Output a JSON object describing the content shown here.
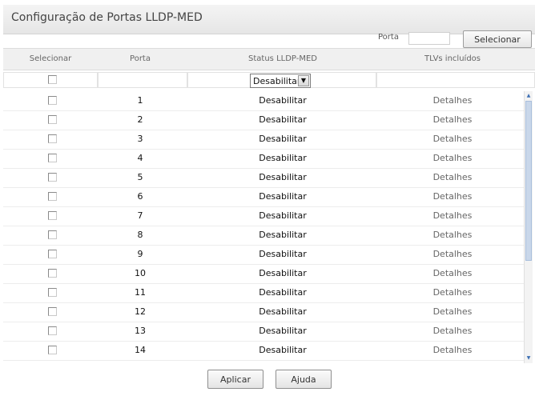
{
  "panel": {
    "title": "Configuração de Portas LLDP-MED"
  },
  "port_search": {
    "label": "Porta",
    "value": "",
    "button_label": "Selecionar"
  },
  "table": {
    "headers": [
      "Selecionar",
      "Porta",
      "Status LLDP-MED",
      "TLVs incluídos"
    ],
    "filter": {
      "status_value": "Desabilitar"
    },
    "rows": [
      {
        "port": "1",
        "status": "Desabilitar",
        "details": "Detalhes"
      },
      {
        "port": "2",
        "status": "Desabilitar",
        "details": "Detalhes"
      },
      {
        "port": "3",
        "status": "Desabilitar",
        "details": "Detalhes"
      },
      {
        "port": "4",
        "status": "Desabilitar",
        "details": "Detalhes"
      },
      {
        "port": "5",
        "status": "Desabilitar",
        "details": "Detalhes"
      },
      {
        "port": "6",
        "status": "Desabilitar",
        "details": "Detalhes"
      },
      {
        "port": "7",
        "status": "Desabilitar",
        "details": "Detalhes"
      },
      {
        "port": "8",
        "status": "Desabilitar",
        "details": "Detalhes"
      },
      {
        "port": "9",
        "status": "Desabilitar",
        "details": "Detalhes"
      },
      {
        "port": "10",
        "status": "Desabilitar",
        "details": "Detalhes"
      },
      {
        "port": "11",
        "status": "Desabilitar",
        "details": "Detalhes"
      },
      {
        "port": "12",
        "status": "Desabilitar",
        "details": "Detalhes"
      },
      {
        "port": "13",
        "status": "Desabilitar",
        "details": "Detalhes"
      },
      {
        "port": "14",
        "status": "Desabilitar",
        "details": "Detalhes"
      }
    ]
  },
  "actions": {
    "apply_label": "Aplicar",
    "help_label": "Ajuda"
  },
  "icons": {
    "dropdown": "chevron-down-icon",
    "scroll_up": "arrow-up-icon",
    "scroll_down": "arrow-down-icon"
  },
  "colors": {
    "title_bar": "#e9e9e9",
    "header_row": "#f0f0f0",
    "scroll_thumb": "#c9d7ea"
  }
}
